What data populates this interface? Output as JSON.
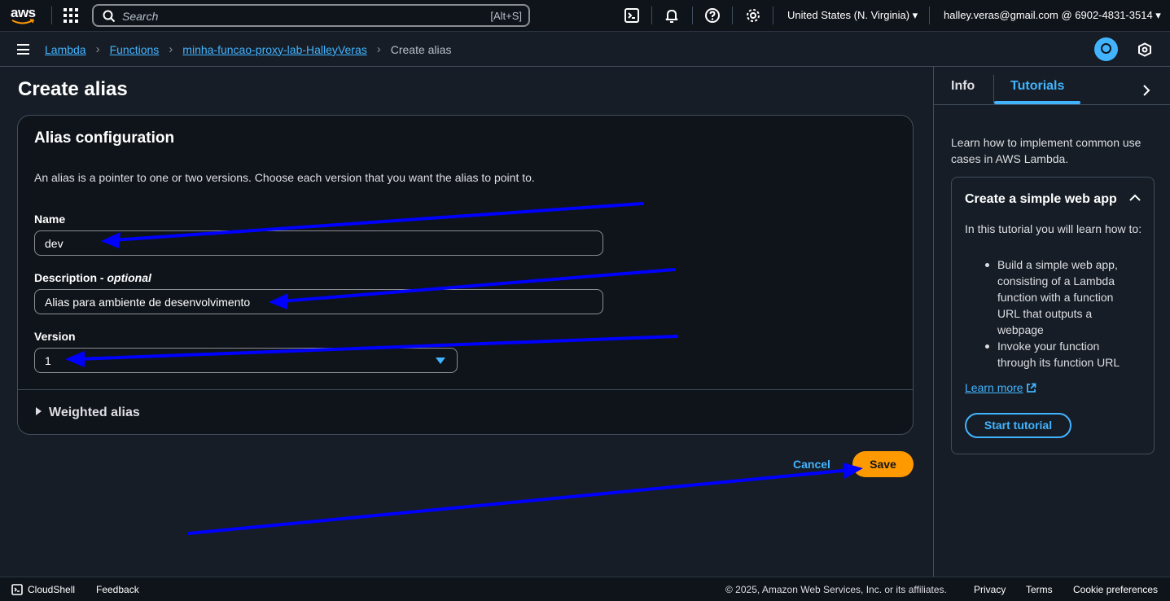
{
  "topnav": {
    "logo_text": "aws",
    "search_placeholder": "Search",
    "search_shortcut": "[Alt+S]",
    "region": "United States (N. Virginia) ▾",
    "account": "halley.veras@gmail.com @ 6902-4831-3514 ▾"
  },
  "breadcrumb": {
    "items": [
      "Lambda",
      "Functions",
      "minha-funcao-proxy-lab-HalleyVeras"
    ],
    "current": "Create alias"
  },
  "main": {
    "title": "Create alias",
    "panel": {
      "title": "Alias configuration",
      "description": "An alias is a pointer to one or two versions. Choose each version that you want the alias to point to.",
      "name_label": "Name",
      "name_value": "dev",
      "description_label": "Description - ",
      "description_optional": "optional",
      "description_value": "Alias para ambiente de desenvolvimento",
      "version_label": "Version",
      "version_value": "1",
      "weighted_alias": "Weighted alias"
    },
    "cancel_label": "Cancel",
    "save_label": "Save"
  },
  "side_panel": {
    "tabs": [
      "Info",
      "Tutorials"
    ],
    "active_tab": "Tutorials",
    "intro": "Learn how to implement common use cases in AWS Lambda.",
    "card": {
      "title": "Create a simple web app",
      "text": "In this tutorial you will learn how to:",
      "bullets": [
        "Build a simple web app, consisting of a Lambda function with a function URL that outputs a webpage",
        "Invoke your function through its function URL"
      ],
      "learn_more": "Learn more",
      "start_button": "Start tutorial"
    }
  },
  "footer": {
    "cloudshell": "CloudShell",
    "feedback": "Feedback",
    "copyright": "© 2025, Amazon Web Services, Inc. or its affiliates.",
    "privacy": "Privacy",
    "terms": "Terms",
    "cookies": "Cookie preferences"
  },
  "colors": {
    "accent": "#42b4ff",
    "primary_button": "#ff9900",
    "background": "#161d26",
    "annotation_arrow": "#0000ff"
  },
  "icons": [
    "search-icon",
    "apps-grid-icon",
    "cloudshell-icon",
    "bell-icon",
    "help-icon",
    "gear-icon",
    "menu-icon",
    "info-icon",
    "shield-icon",
    "chevron-right-icon",
    "caret-up-icon",
    "external-link-icon",
    "caret-right-icon",
    "caret-down-icon"
  ]
}
